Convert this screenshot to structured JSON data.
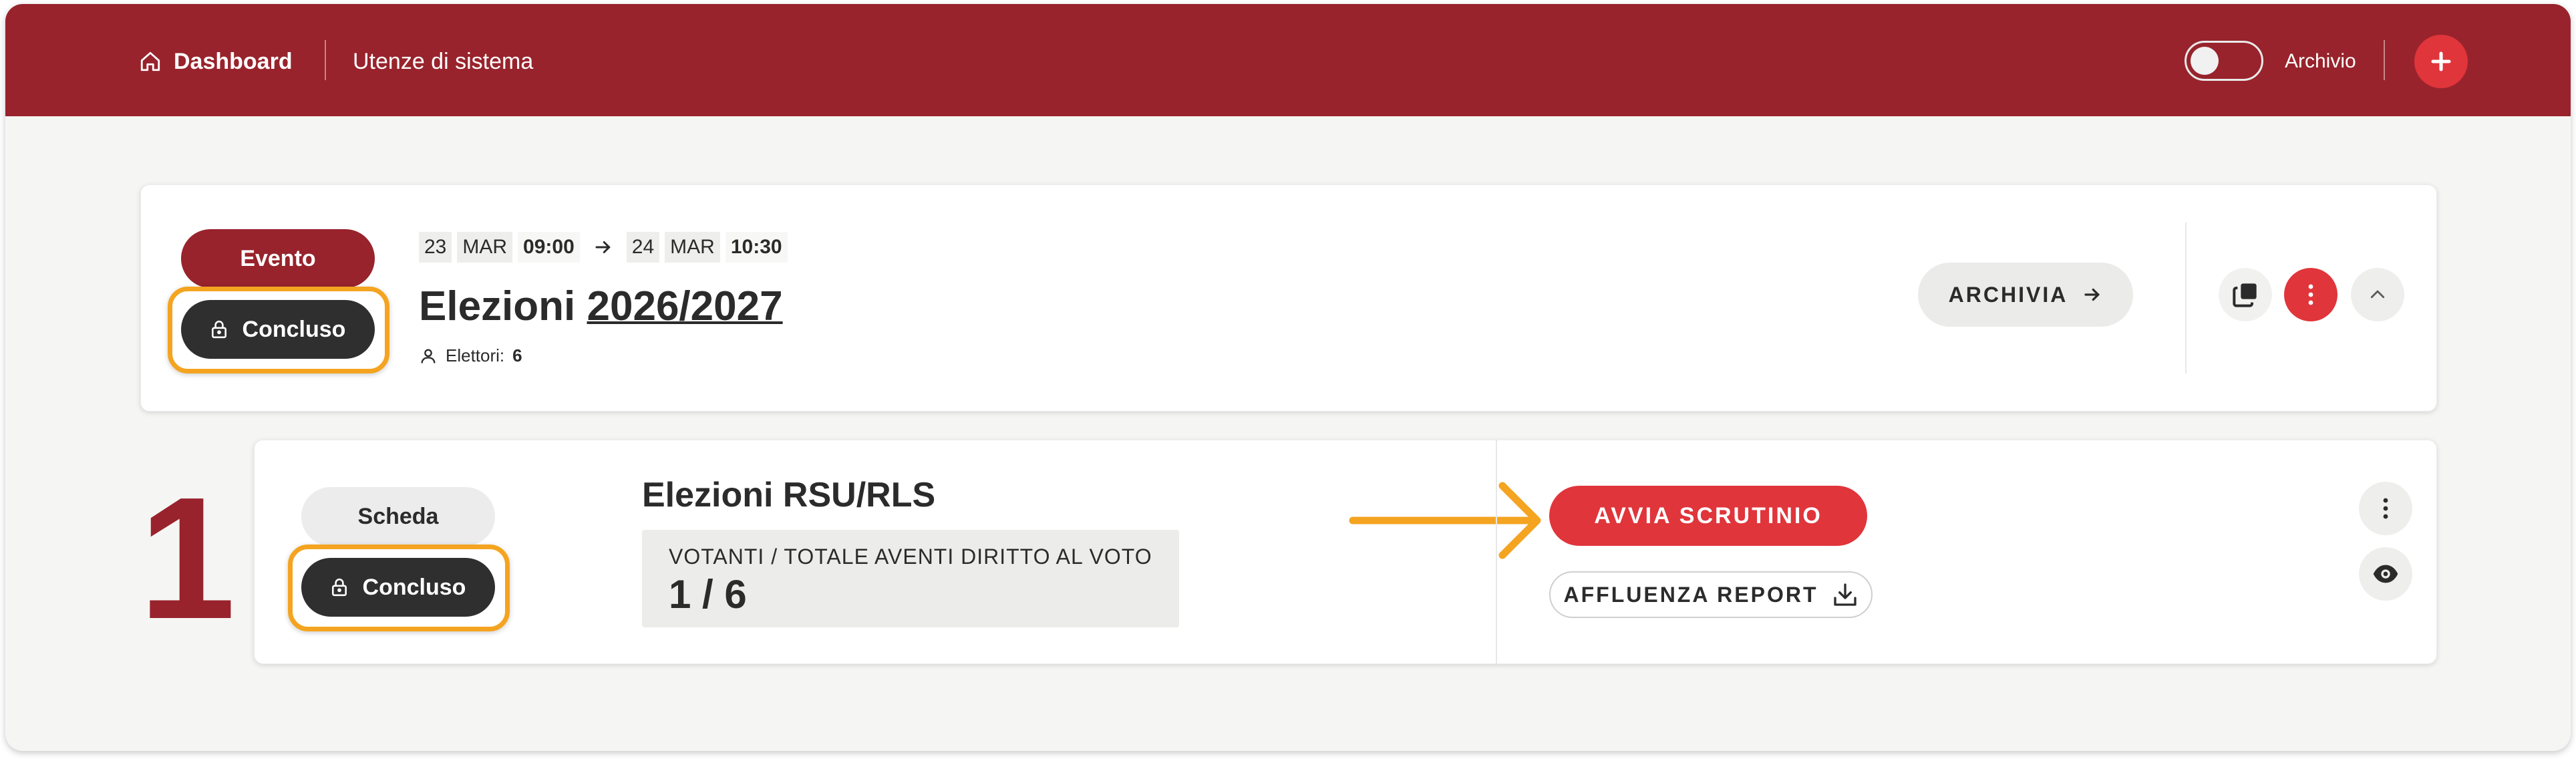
{
  "header": {
    "dashboard_label": "Dashboard",
    "users_label": "Utenze di sistema",
    "archive_toggle_label": "Archivio",
    "archive_toggle_on": false
  },
  "event": {
    "type_badge": "Evento",
    "status_badge": "Concluso",
    "start": {
      "day": "23",
      "month": "MAR",
      "time": "09:00"
    },
    "end": {
      "day": "24",
      "month": "MAR",
      "time": "10:30"
    },
    "title_prefix": "Elezioni",
    "title_year": "2026/2027",
    "voters_label": "Elettori:",
    "voters_count": "6",
    "archive_button": "ARCHIVIA"
  },
  "ballot": {
    "number": "1",
    "type_badge": "Scheda",
    "status_badge": "Concluso",
    "title": "Elezioni RSU/RLS",
    "voters_label": "VOTANTI / TOTALE AVENTI DIRITTO AL VOTO",
    "voters_value": "1 / 6",
    "start_count_button": "AVVIA SCRUTINIO",
    "turnout_report_button": "AFFLUENZA REPORT"
  },
  "colors": {
    "brand": "#98232c",
    "accent": "#e0353b",
    "highlight": "#f4a420",
    "dark_pill": "#2f2f2f"
  }
}
